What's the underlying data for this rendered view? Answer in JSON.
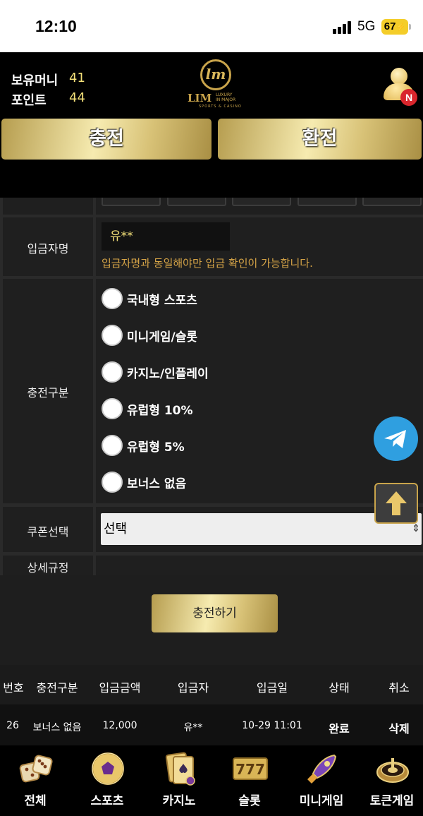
{
  "status": {
    "time": "12:10",
    "network": "5G",
    "battery": "67"
  },
  "header": {
    "money_label": "보유머니",
    "money_value": "41",
    "point_label": "포인트",
    "point_value": "44",
    "logo_text": "LIM",
    "logo_tag": "LUXURY IN MAJOR",
    "logo_sub": "SPORTS & CASINO",
    "user_badge": "N"
  },
  "tabs": {
    "charge": "충전",
    "exchange": "환전"
  },
  "form": {
    "depositor_label": "입금자명",
    "depositor_value": "유**",
    "depositor_notice": "입금자명과 동일해야만 입금 확인이 가능합니다.",
    "category_label": "충전구분",
    "categories": [
      "국내형 스포츠",
      "미니게임/슬롯",
      "카지노/인플레이",
      "유럽형 10%",
      "유럽형 5%",
      "보너스 없음"
    ],
    "coupon_label": "쿠폰선택",
    "coupon_value": "선택",
    "rules_label": "상세규정",
    "submit": "충전하기"
  },
  "table": {
    "headers": [
      "번호",
      "충전구분",
      "입금금액",
      "입금자",
      "입금일",
      "상태",
      "취소"
    ],
    "rows": [
      [
        "26",
        "보너스 없음",
        "12,000",
        "유**",
        "10-29 11:01",
        "완료",
        "삭제"
      ]
    ]
  },
  "bottom_nav": [
    {
      "label": "전체",
      "icon": "dice-icon"
    },
    {
      "label": "스포츠",
      "icon": "soccer-ball-icon"
    },
    {
      "label": "카지노",
      "icon": "cards-icon"
    },
    {
      "label": "슬롯",
      "icon": "slot-777-icon"
    },
    {
      "label": "미니게임",
      "icon": "rocket-icon"
    },
    {
      "label": "토큰게임",
      "icon": "roulette-icon"
    }
  ],
  "colors": {
    "gold": "#d8c277",
    "accent_text": "#f3e079",
    "notice": "#d7a547",
    "telegram": "#2f9fe0",
    "badge": "#d9262d"
  }
}
